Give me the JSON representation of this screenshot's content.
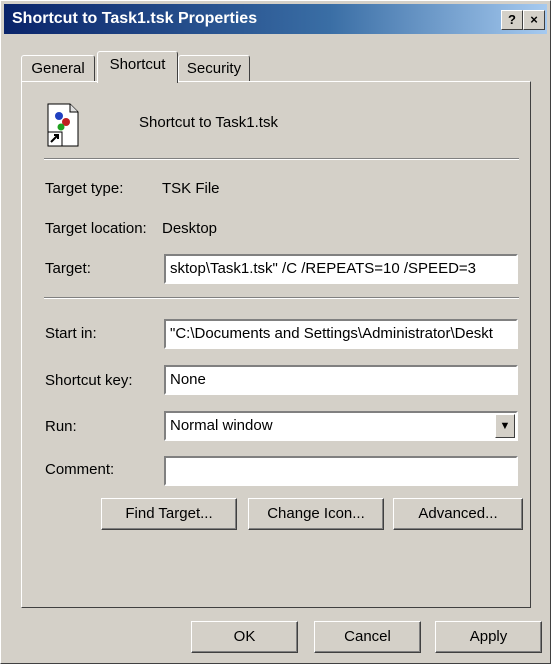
{
  "window": {
    "title": "Shortcut to Task1.tsk Properties",
    "help_btn": "?",
    "close_btn": "×"
  },
  "tabs": [
    {
      "label": "General"
    },
    {
      "label": "Shortcut",
      "active": true
    },
    {
      "label": "Security"
    }
  ],
  "shortcut": {
    "name": "Shortcut to Task1.tsk",
    "icon": "task-file-shortcut-icon",
    "target_type_label": "Target type:",
    "target_type_value": "TSK File",
    "target_location_label": "Target location:",
    "target_location_value": "Desktop",
    "target_label": "Target:",
    "target_value": "sktop\\Task1.tsk\" /C /REPEATS=10 /SPEED=3",
    "start_in_label": "Start in:",
    "start_in_value": "\"C:\\Documents and Settings\\Administrator\\Deskt",
    "shortcut_key_label": "Shortcut key:",
    "shortcut_key_value": "None",
    "run_label": "Run:",
    "run_value": "Normal window",
    "comment_label": "Comment:",
    "comment_value": ""
  },
  "buttons": {
    "find_target": "Find Target...",
    "change_icon": "Change Icon...",
    "advanced": "Advanced...",
    "ok": "OK",
    "cancel": "Cancel",
    "apply": "Apply"
  }
}
